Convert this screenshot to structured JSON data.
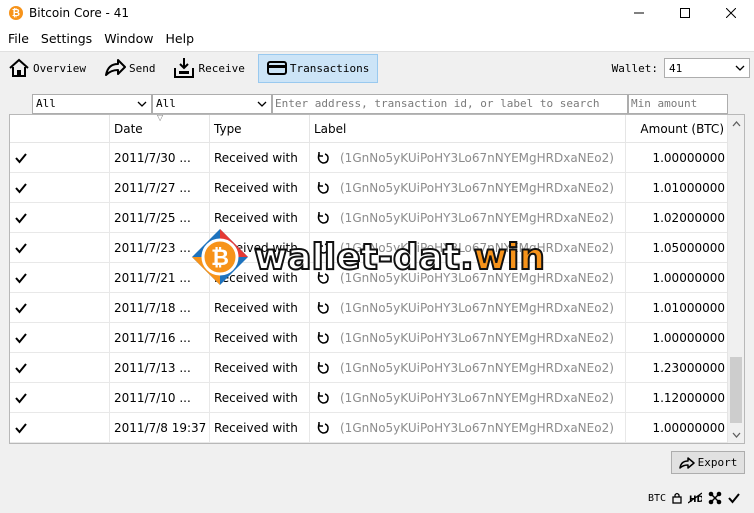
{
  "window": {
    "title": "Bitcoin Core - 41"
  },
  "menu": [
    "File",
    "Settings",
    "Window",
    "Help"
  ],
  "toolbar": {
    "items": [
      {
        "label": "Overview",
        "icon": "home-icon"
      },
      {
        "label": "Send",
        "icon": "send-icon"
      },
      {
        "label": "Receive",
        "icon": "receive-icon"
      },
      {
        "label": "Transactions",
        "icon": "transactions-icon",
        "active": true
      }
    ],
    "wallet_label": "Wallet:",
    "wallet_value": "41"
  },
  "filters": {
    "date_range": "All",
    "type": "All",
    "search_placeholder": "Enter address, transaction id, or label to search",
    "min_amount_placeholder": "Min amount"
  },
  "table": {
    "columns": [
      "",
      "Date",
      "Type",
      "Label",
      "Amount (BTC)"
    ],
    "rows": [
      {
        "date": "2011/7/30 ...",
        "type": "Received with",
        "label": "(1GnNo5yKUiPoHY3Lo67nNYEMgHRDxaNEo2)",
        "amount": "1.00000000"
      },
      {
        "date": "2011/7/27 ...",
        "type": "Received with",
        "label": "(1GnNo5yKUiPoHY3Lo67nNYEMgHRDxaNEo2)",
        "amount": "1.01000000"
      },
      {
        "date": "2011/7/25 ...",
        "type": "Received with",
        "label": "(1GnNo5yKUiPoHY3Lo67nNYEMgHRDxaNEo2)",
        "amount": "1.02000000"
      },
      {
        "date": "2011/7/23 ...",
        "type": "Received with",
        "label": "(1GnNo5yKUiPoHY3Lo67nNYEMgHRDxaNEo2)",
        "amount": "1.05000000"
      },
      {
        "date": "2011/7/21 ...",
        "type": "Received with",
        "label": "(1GnNo5yKUiPoHY3Lo67nNYEMgHRDxaNEo2)",
        "amount": "1.00000000"
      },
      {
        "date": "2011/7/18 ...",
        "type": "Received with",
        "label": "(1GnNo5yKUiPoHY3Lo67nNYEMgHRDxaNEo2)",
        "amount": "1.01000000"
      },
      {
        "date": "2011/7/16 ...",
        "type": "Received with",
        "label": "(1GnNo5yKUiPoHY3Lo67nNYEMgHRDxaNEo2)",
        "amount": "1.00000000"
      },
      {
        "date": "2011/7/13 ...",
        "type": "Received with",
        "label": "(1GnNo5yKUiPoHY3Lo67nNYEMgHRDxaNEo2)",
        "amount": "1.23000000"
      },
      {
        "date": "2011/7/10 ...",
        "type": "Received with",
        "label": "(1GnNo5yKUiPoHY3Lo67nNYEMgHRDxaNEo2)",
        "amount": "1.12000000"
      },
      {
        "date": "2011/7/8 19:37",
        "type": "Received with",
        "label": "(1GnNo5yKUiPoHY3Lo67nNYEMgHRDxaNEo2)",
        "amount": "1.00000000"
      }
    ]
  },
  "export_label": "Export",
  "status": {
    "unit": "BTC"
  },
  "watermark": {
    "part1": "wallet-dat.",
    "part2": "win"
  },
  "colors": {
    "bitcoin_orange": "#f7931a",
    "active_tab": "#cce4f7"
  }
}
